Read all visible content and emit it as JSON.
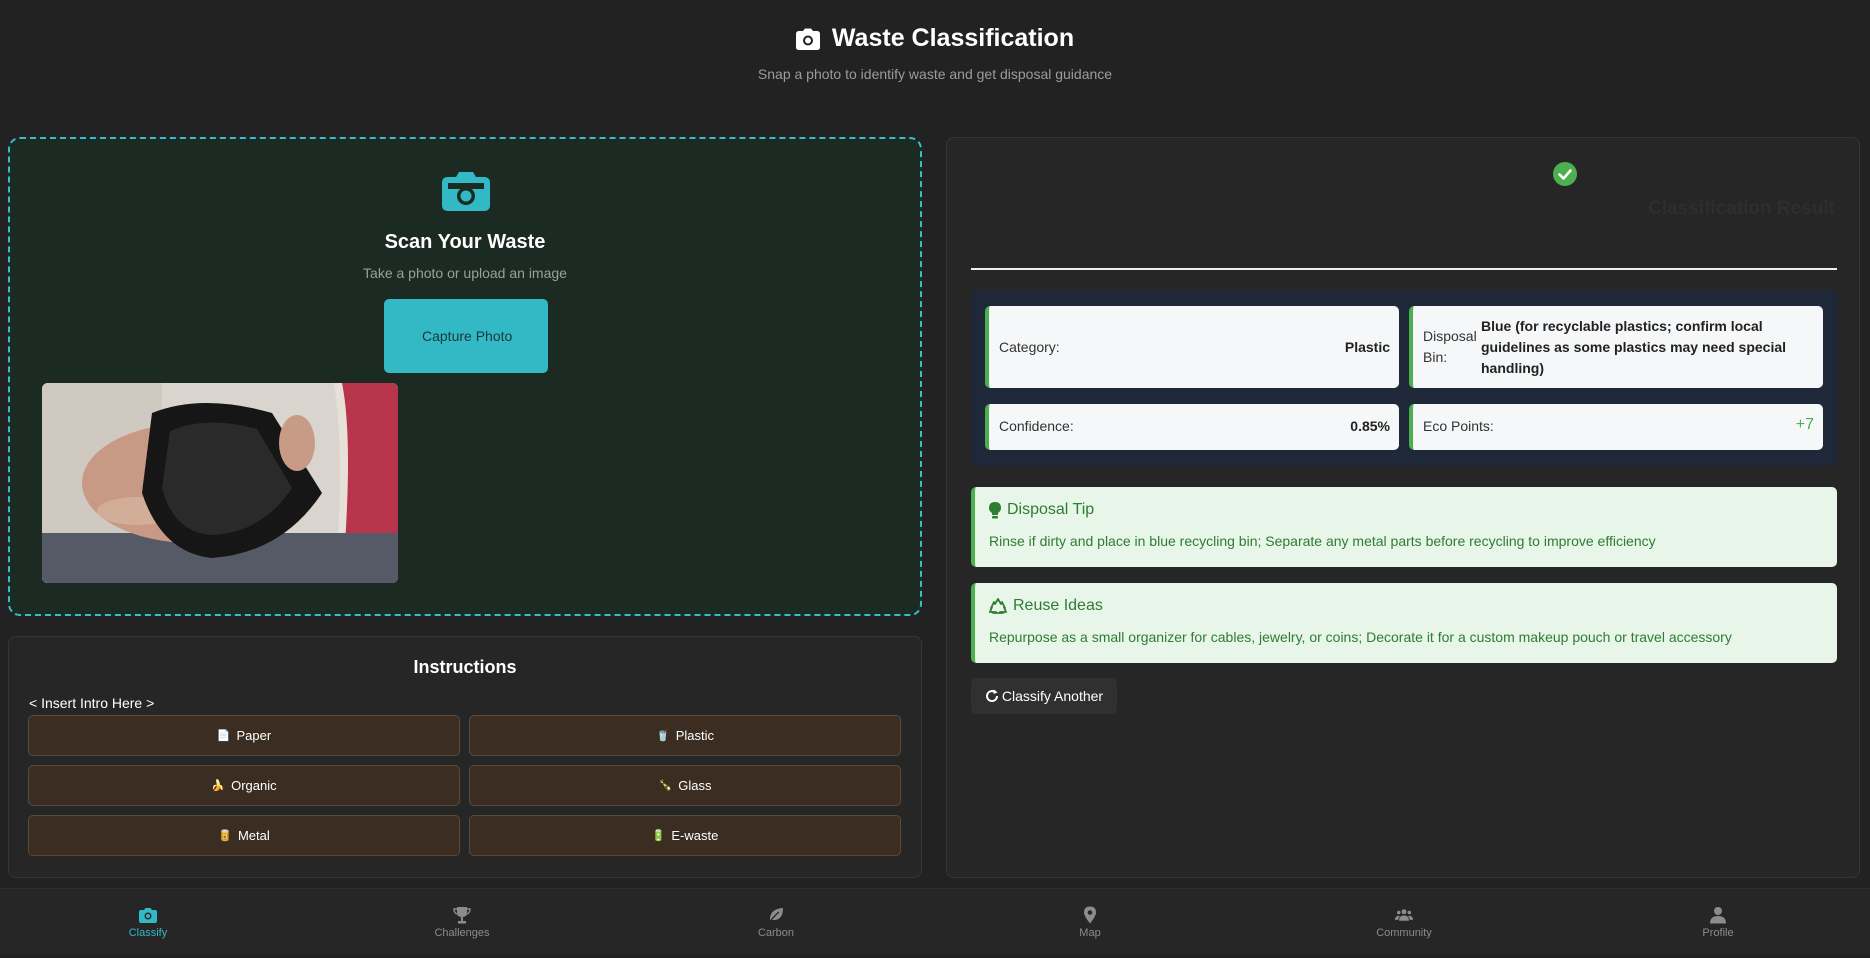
{
  "header": {
    "title": "Waste Classification",
    "subtitle": "Snap a photo to identify waste and get disposal guidance",
    "icon": "camera-icon"
  },
  "scan": {
    "title": "Scan Your Waste",
    "subtitle": "Take a photo or upload an image",
    "capture_label": "Capture Photo",
    "icon": "camera-icon"
  },
  "instructions": {
    "title": "Instructions",
    "intro": "< Insert Intro Here >",
    "categories": [
      {
        "label": "Paper",
        "emoji": "📄"
      },
      {
        "label": "Plastic",
        "emoji": "🥤"
      },
      {
        "label": "Organic",
        "emoji": "🍌"
      },
      {
        "label": "Glass",
        "emoji": "🍾"
      },
      {
        "label": "Metal",
        "emoji": "🥫"
      },
      {
        "label": "E-waste",
        "emoji": "🔋"
      }
    ]
  },
  "result": {
    "title": "Classification Result",
    "category_label": "Category:",
    "category_value": "Plastic",
    "bin_label": "Disposal Bin:",
    "bin_value": "Blue (for recyclable plastics; confirm local guidelines as some plastics may need special handling)",
    "confidence_label": "Confidence:",
    "confidence_value": "0.85%",
    "points_label": "Eco Points:",
    "points_value": "+7",
    "tip_title": "Disposal Tip",
    "tip_text": "Rinse if dirty and place in blue recycling bin; Separate any metal parts before recycling to improve efficiency",
    "reuse_title": "Reuse Ideas",
    "reuse_text": "Repurpose as a small organizer for cables, jewelry, or coins; Decorate it for a custom makeup pouch or travel accessory",
    "classify_another": "Classify Another"
  },
  "nav": [
    {
      "label": "Classify",
      "icon": "camera-icon",
      "active": true
    },
    {
      "label": "Challenges",
      "icon": "trophy-icon",
      "active": false
    },
    {
      "label": "Carbon",
      "icon": "leaf-icon",
      "active": false
    },
    {
      "label": "Map",
      "icon": "map-pin-icon",
      "active": false
    },
    {
      "label": "Community",
      "icon": "users-icon",
      "active": false
    },
    {
      "label": "Profile",
      "icon": "user-icon",
      "active": false
    }
  ],
  "colors": {
    "accent": "#33b9c6",
    "success": "#4caf50",
    "tip_bg": "#e8f5e9",
    "category_btn": "#3b2d22"
  }
}
